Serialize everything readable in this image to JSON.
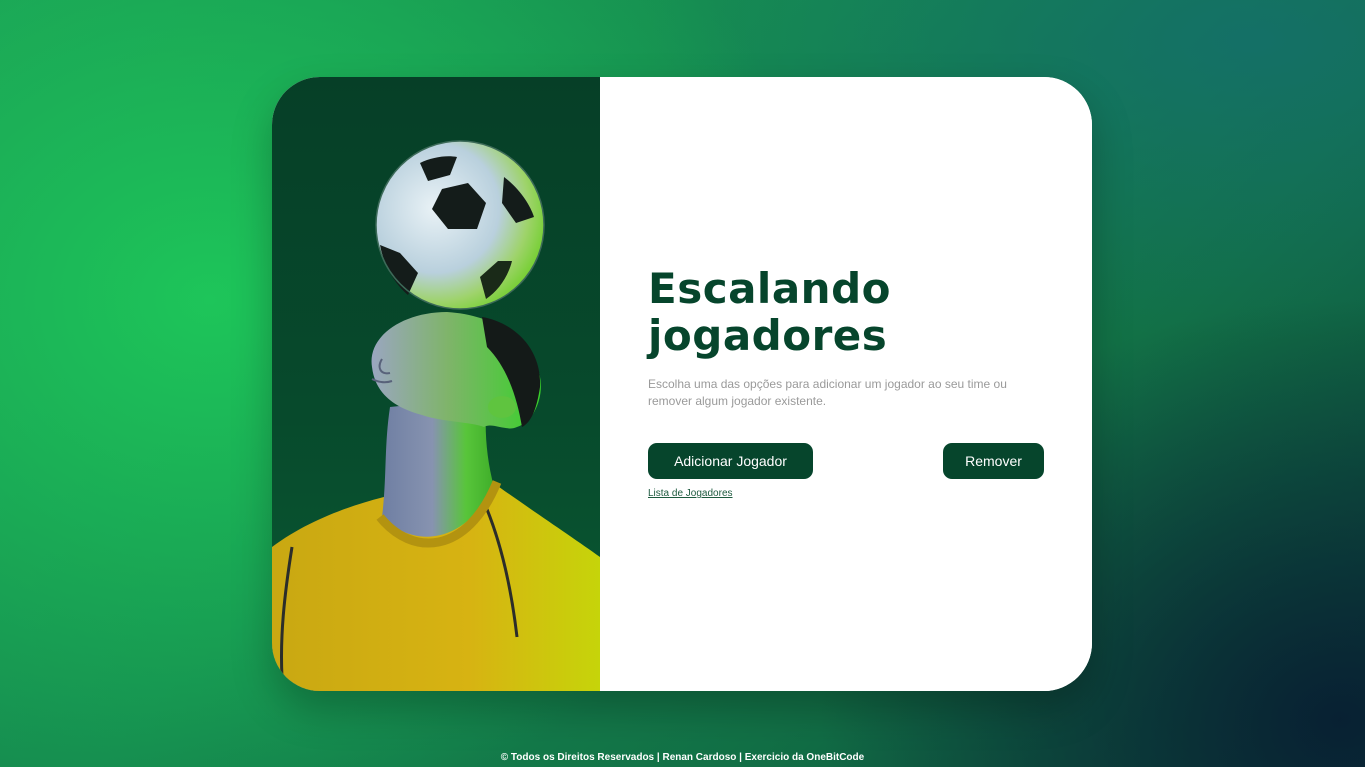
{
  "hero": {
    "image": "player-heading-soccer-ball"
  },
  "main": {
    "title_line1": "Escalando",
    "title_line2": "jogadores",
    "subtitle": "Escolha uma das opções para adicionar um jogador ao seu time ou remover algum jogador existente.",
    "add_button": "Adicionar Jogador",
    "remove_button": "Remover",
    "list_link": "Lista de Jogadores"
  },
  "footer": {
    "text": "© Todos os Direitos Reservados | Renan Cardoso | Exercicio da OneBitCode"
  },
  "colors": {
    "primary": "#06452c",
    "card_background": "#ffffff",
    "subtitle": "#9a9a9a"
  }
}
